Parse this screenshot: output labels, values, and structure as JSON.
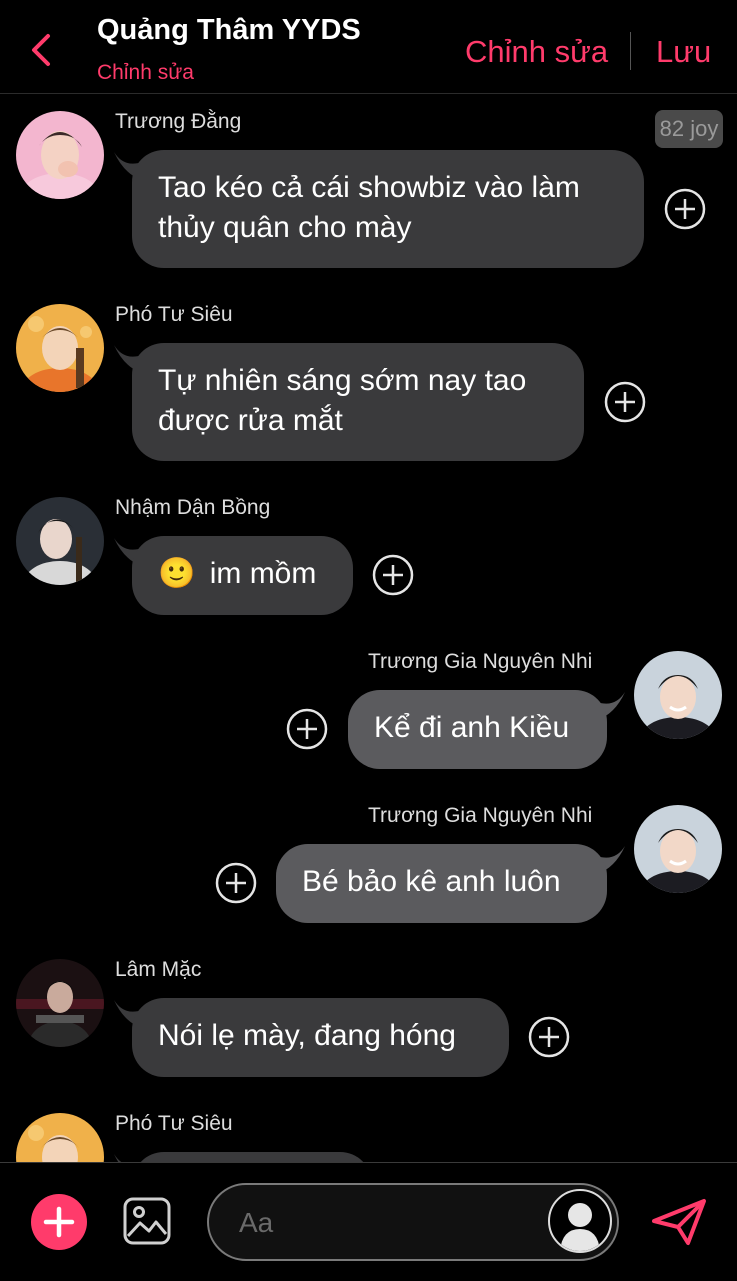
{
  "header": {
    "title": "Quảng Thâm YYDS",
    "subtitle": "Chỉnh sửa",
    "edit_label": "Chỉnh sửa",
    "save_label": "Lưu"
  },
  "badge": {
    "joy": "82 joy"
  },
  "messages": [
    {
      "sender": "Trương Đằng",
      "lines": [
        "Tao kéo cả cái showbiz vào làm",
        "thủy quân cho mày"
      ]
    },
    {
      "sender": "Phó Tư Siêu",
      "lines": [
        "Tự nhiên sáng sớm nay tao",
        "được rửa mắt"
      ]
    },
    {
      "sender": "Nhậm Dận Bồng",
      "text": "im mồm",
      "emoji": "🙂"
    },
    {
      "sender": "Trương Gia Nguyên Nhi",
      "text": "Kể đi anh Kiều"
    },
    {
      "sender": "Trương Gia Nguyên Nhi",
      "text": "Bé bảo kê anh luôn"
    },
    {
      "sender": "Lâm Mặc",
      "text": "Nói lẹ mày, đang hóng"
    },
    {
      "sender": "Phó Tư Siêu",
      "text": ""
    }
  ],
  "composer": {
    "placeholder": "Aa"
  },
  "colors": {
    "accent": "#ff3b6b",
    "bubble_left": "#3a3a3c",
    "bubble_right": "#5b5b5e",
    "background": "#000000"
  },
  "icons": [
    "back-chevron-icon",
    "add-reaction-icon",
    "plus-icon",
    "image-icon",
    "user-silhouette-icon",
    "send-icon"
  ]
}
